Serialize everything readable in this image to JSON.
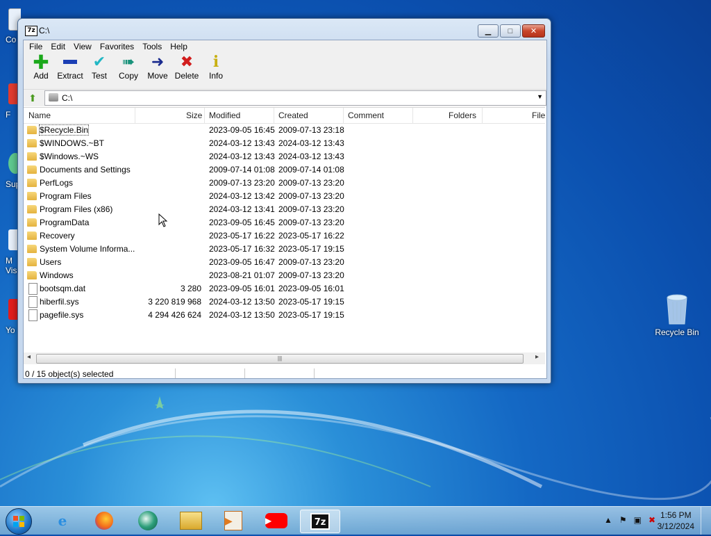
{
  "window": {
    "title": "C:\\",
    "app_icon": "7z",
    "menu": [
      "File",
      "Edit",
      "View",
      "Favorites",
      "Tools",
      "Help"
    ],
    "toolbar": [
      {
        "label": "Add",
        "icon": "plus-icon",
        "color": "#1aa81a"
      },
      {
        "label": "Extract",
        "icon": "minus-icon",
        "color": "#1b3fb5"
      },
      {
        "label": "Test",
        "icon": "checkmark-icon",
        "color": "#22b7c4"
      },
      {
        "label": "Copy",
        "icon": "arrow-right-double-icon",
        "color": "#18927a"
      },
      {
        "label": "Move",
        "icon": "arrow-right-icon",
        "color": "#1a2b8f"
      },
      {
        "label": "Delete",
        "icon": "x-icon",
        "color": "#d11d1d"
      },
      {
        "label": "Info",
        "icon": "info-icon",
        "color": "#c8b012"
      }
    ],
    "address": "C:\\",
    "columns": [
      "Name",
      "Size",
      "Modified",
      "Created",
      "Comment",
      "Folders",
      "File"
    ],
    "rows": [
      {
        "type": "folder",
        "name": "$Recycle.Bin",
        "size": "",
        "modified": "2023-09-05 16:45",
        "created": "2009-07-13 23:18"
      },
      {
        "type": "folder",
        "name": "$WINDOWS.~BT",
        "size": "",
        "modified": "2024-03-12 13:43",
        "created": "2024-03-12 13:43"
      },
      {
        "type": "folder",
        "name": "$Windows.~WS",
        "size": "",
        "modified": "2024-03-12 13:43",
        "created": "2024-03-12 13:43"
      },
      {
        "type": "folder",
        "name": "Documents and Settings",
        "size": "",
        "modified": "2009-07-14 01:08",
        "created": "2009-07-14 01:08"
      },
      {
        "type": "folder",
        "name": "PerfLogs",
        "size": "",
        "modified": "2009-07-13 23:20",
        "created": "2009-07-13 23:20"
      },
      {
        "type": "folder",
        "name": "Program Files",
        "size": "",
        "modified": "2024-03-12 13:42",
        "created": "2009-07-13 23:20"
      },
      {
        "type": "folder",
        "name": "Program Files (x86)",
        "size": "",
        "modified": "2024-03-12 13:41",
        "created": "2009-07-13 23:20"
      },
      {
        "type": "folder",
        "name": "ProgramData",
        "size": "",
        "modified": "2023-09-05 16:45",
        "created": "2009-07-13 23:20"
      },
      {
        "type": "folder",
        "name": "Recovery",
        "size": "",
        "modified": "2023-05-17 16:22",
        "created": "2023-05-17 16:22"
      },
      {
        "type": "folder",
        "name": "System Volume Informa...",
        "size": "",
        "modified": "2023-05-17 16:32",
        "created": "2023-05-17 19:15"
      },
      {
        "type": "folder",
        "name": "Users",
        "size": "",
        "modified": "2023-09-05 16:47",
        "created": "2009-07-13 23:20"
      },
      {
        "type": "folder",
        "name": "Windows",
        "size": "",
        "modified": "2023-08-21 01:07",
        "created": "2009-07-13 23:20"
      },
      {
        "type": "file",
        "name": "bootsqm.dat",
        "size": "3 280",
        "modified": "2023-09-05 16:01",
        "created": "2023-09-05 16:01"
      },
      {
        "type": "sysfile",
        "name": "hiberfil.sys",
        "size": "3 220 819 968",
        "modified": "2024-03-12 13:50",
        "created": "2023-05-17 19:15"
      },
      {
        "type": "sysfile",
        "name": "pagefile.sys",
        "size": "4 294 426 624",
        "modified": "2024-03-12 13:50",
        "created": "2023-05-17 19:15"
      }
    ],
    "status": "0 / 15 object(s) selected"
  },
  "desktop": {
    "left_labels": [
      "Co",
      "F",
      "Sup",
      "M\nVisu",
      "Yo"
    ],
    "recycle_bin": "Recycle Bin"
  },
  "taskbar": {
    "apps": [
      "internet-explorer-icon",
      "firefox-icon",
      "browser-icon",
      "file-explorer-icon",
      "media-player-icon",
      "youtube-icon",
      "7zip-icon"
    ],
    "active_app": "7z",
    "time": "1:56 PM",
    "date": "3/12/2024"
  }
}
